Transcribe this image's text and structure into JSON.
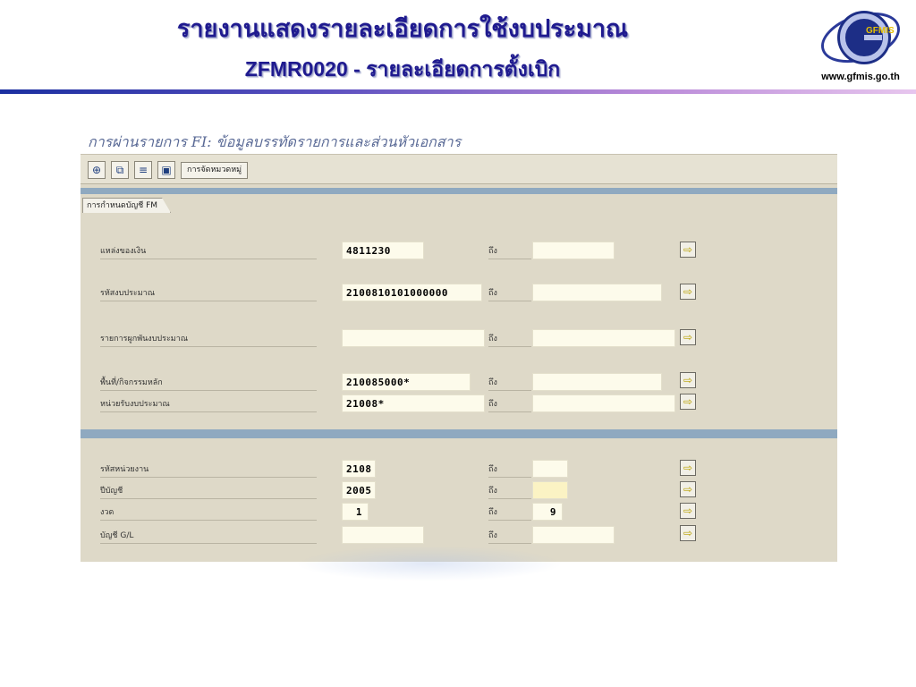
{
  "slide": {
    "title_line1": "รายงานแสดงรายละเอียดการใช้งบประมาณ",
    "title_line2": "ZFMR0020 - รายละเอียดการตั้งเบิก",
    "logo_text": "GFMIS",
    "website": "www.gfmis.go.th"
  },
  "sap": {
    "screen_title": "การผ่านรายการ FI: ข้อมูลบรรทัดรายการและส่วนหัวเอกสาร",
    "toolbar": {
      "icons": [
        "execute-icon",
        "copy-icon",
        "selection-options-icon",
        "save-variant-icon"
      ],
      "button_label": "การจัดหมวดหมู่"
    },
    "tab_label": "การกำหนดบัญชี FM",
    "to_label": "ถึง",
    "section1": [
      {
        "label": "แหล่งของเงิน",
        "from": "4811230",
        "to": ""
      },
      {
        "label": "รหัสงบประมาณ",
        "from": "2100810101000000",
        "to": ""
      },
      {
        "label": "รายการผูกพันงบประมาณ",
        "from": "",
        "to": ""
      },
      {
        "label": "พื้นที่/กิจกรรมหลัก",
        "from": "210085000*",
        "to": ""
      },
      {
        "label": "หน่วยรับงบประมาณ",
        "from": "21008*",
        "to": ""
      }
    ],
    "section2": [
      {
        "label": "รหัสหน่วยงาน",
        "from": "2108",
        "to": ""
      },
      {
        "label": "ปีบัญชี",
        "from": "2005",
        "to": ""
      },
      {
        "label": "งวด",
        "from": "1",
        "to": "9"
      },
      {
        "label": "บัญชี G/L",
        "from": "",
        "to": ""
      }
    ],
    "colors": {
      "band": "#8fa9c0",
      "window_bg": "#ded9c8",
      "input_bg": "#fdfbeb",
      "title_blue": "#1f1a8f"
    }
  }
}
